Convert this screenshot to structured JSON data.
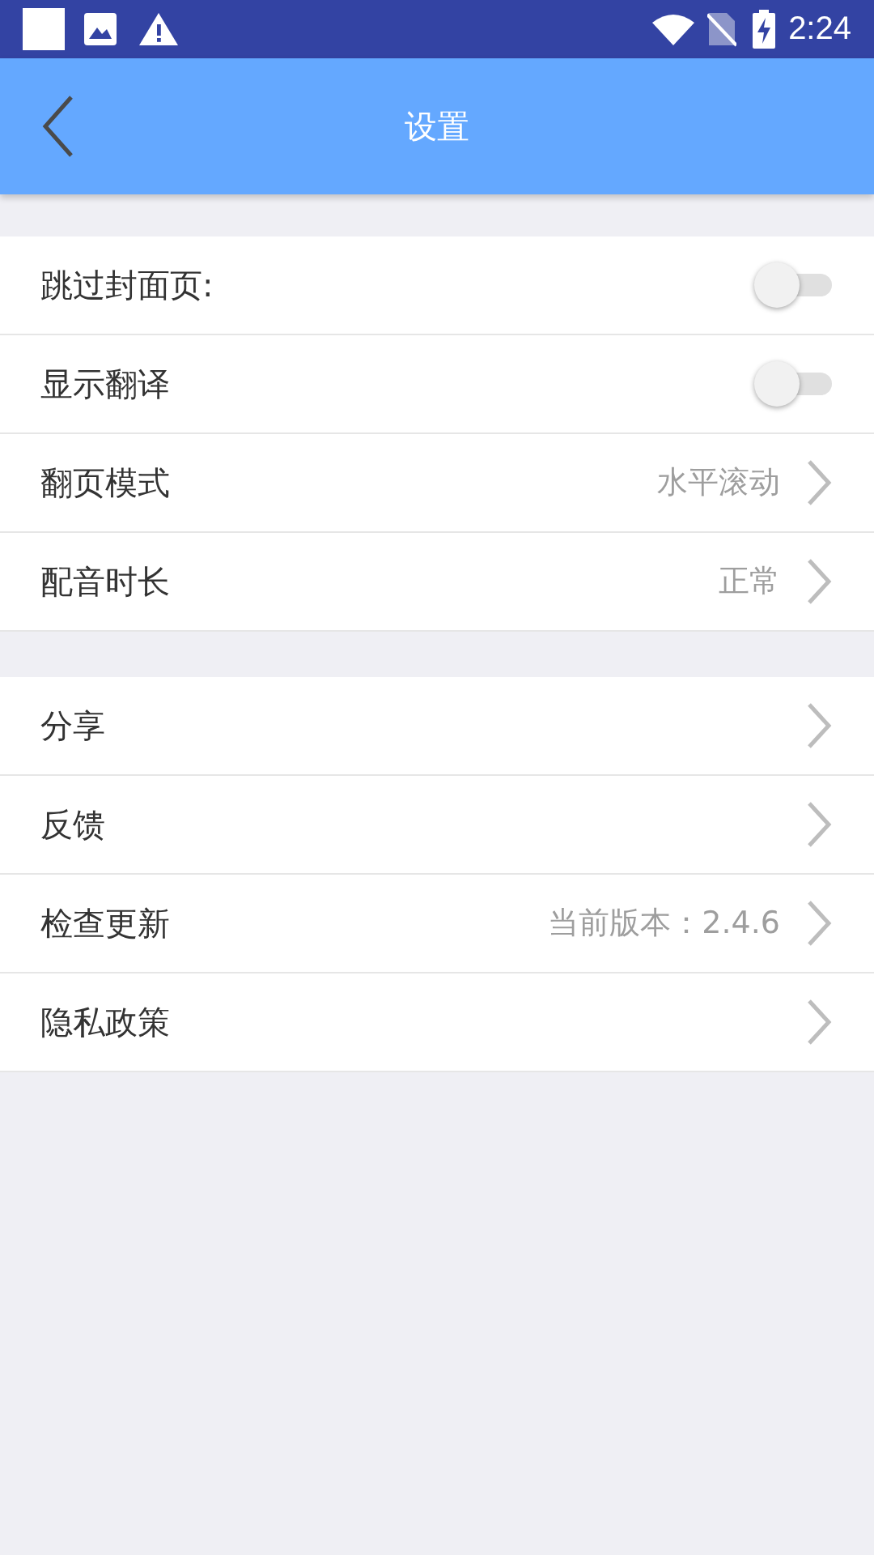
{
  "status_bar": {
    "time": "2:24"
  },
  "header": {
    "title": "设置"
  },
  "groups": [
    {
      "items": [
        {
          "kind": "switch",
          "label": "跳过封面页:",
          "on": false
        },
        {
          "kind": "switch",
          "label": "显示翻译",
          "on": false
        },
        {
          "kind": "link",
          "label": "翻页模式",
          "value": "水平滚动"
        },
        {
          "kind": "link",
          "label": "配音时长",
          "value": "正常"
        }
      ]
    },
    {
      "items": [
        {
          "kind": "link",
          "label": "分享"
        },
        {
          "kind": "link",
          "label": "反馈"
        },
        {
          "kind": "link",
          "label": "检查更新",
          "value": "当前版本：2.4.6"
        },
        {
          "kind": "link",
          "label": "隐私政策"
        }
      ]
    }
  ]
}
